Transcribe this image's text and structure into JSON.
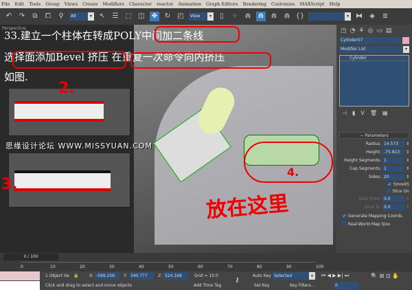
{
  "menu": [
    "File",
    "Edit",
    "Tools",
    "Group",
    "Views",
    "Create",
    "Modifiers",
    "Character",
    "reactor",
    "Animation",
    "Graph Editors",
    "Rendering",
    "Customize",
    "MAXScript",
    "Help"
  ],
  "toolbar": {
    "selection_filter": "All",
    "ref_coord": "View"
  },
  "viewport": {
    "label": "Perspective",
    "annotation": [
      "33.建立一个柱体在转成POLY中间加二条线",
      "选择面添加Bevel 挤压 在重复一次命令向内挤压",
      "如图."
    ],
    "handwritten": [
      "2.",
      "3.",
      "4.",
      "放在这里"
    ],
    "watermark": "思缘设计论坛 WWW.MISSYUAN.COM"
  },
  "panel": {
    "object_name": "Cylinder07",
    "object_color": "#e6a6c6",
    "modifier_list": "Modifier List",
    "stack_item": "Cylinder",
    "rollout": "Parameters",
    "params": [
      {
        "label": "Radius:",
        "value": "14.573"
      },
      {
        "label": "Height:",
        "value": "-75.813"
      },
      {
        "label": "Height Segments:",
        "value": "1"
      },
      {
        "label": "Cap Segments:",
        "value": "1"
      },
      {
        "label": "Sides:",
        "value": "20"
      }
    ],
    "smooth": "Smooth",
    "slice_on": "Slice On",
    "slice_from": {
      "label": "Slice From:",
      "value": "0.0"
    },
    "slice_to": {
      "label": "Slice To:",
      "value": "0.0"
    },
    "gen_mapping": "Generate Mapping Coords.",
    "real_world": "Real-World Map Size"
  },
  "timeline": {
    "frame": "0 / 100",
    "ticks": [
      "0",
      "10",
      "20",
      "30",
      "40",
      "50",
      "60",
      "70",
      "80",
      "90",
      "100"
    ]
  },
  "status": {
    "selection": "1 Object Se",
    "x_label": "X:",
    "x": "-599.256",
    "y_label": "Y:",
    "y": "340.777",
    "z_label": "Z:",
    "z": "524.168",
    "grid": "Grid = 10.0",
    "prompt": "Click and drag to select and move objects",
    "add_time_tag": "Add Time Tag",
    "auto_key": "Auto Key",
    "auto_key_mode": "Selected",
    "set_key": "Set Key",
    "key_filters": "Key Filters...",
    "current_frame": "0"
  }
}
